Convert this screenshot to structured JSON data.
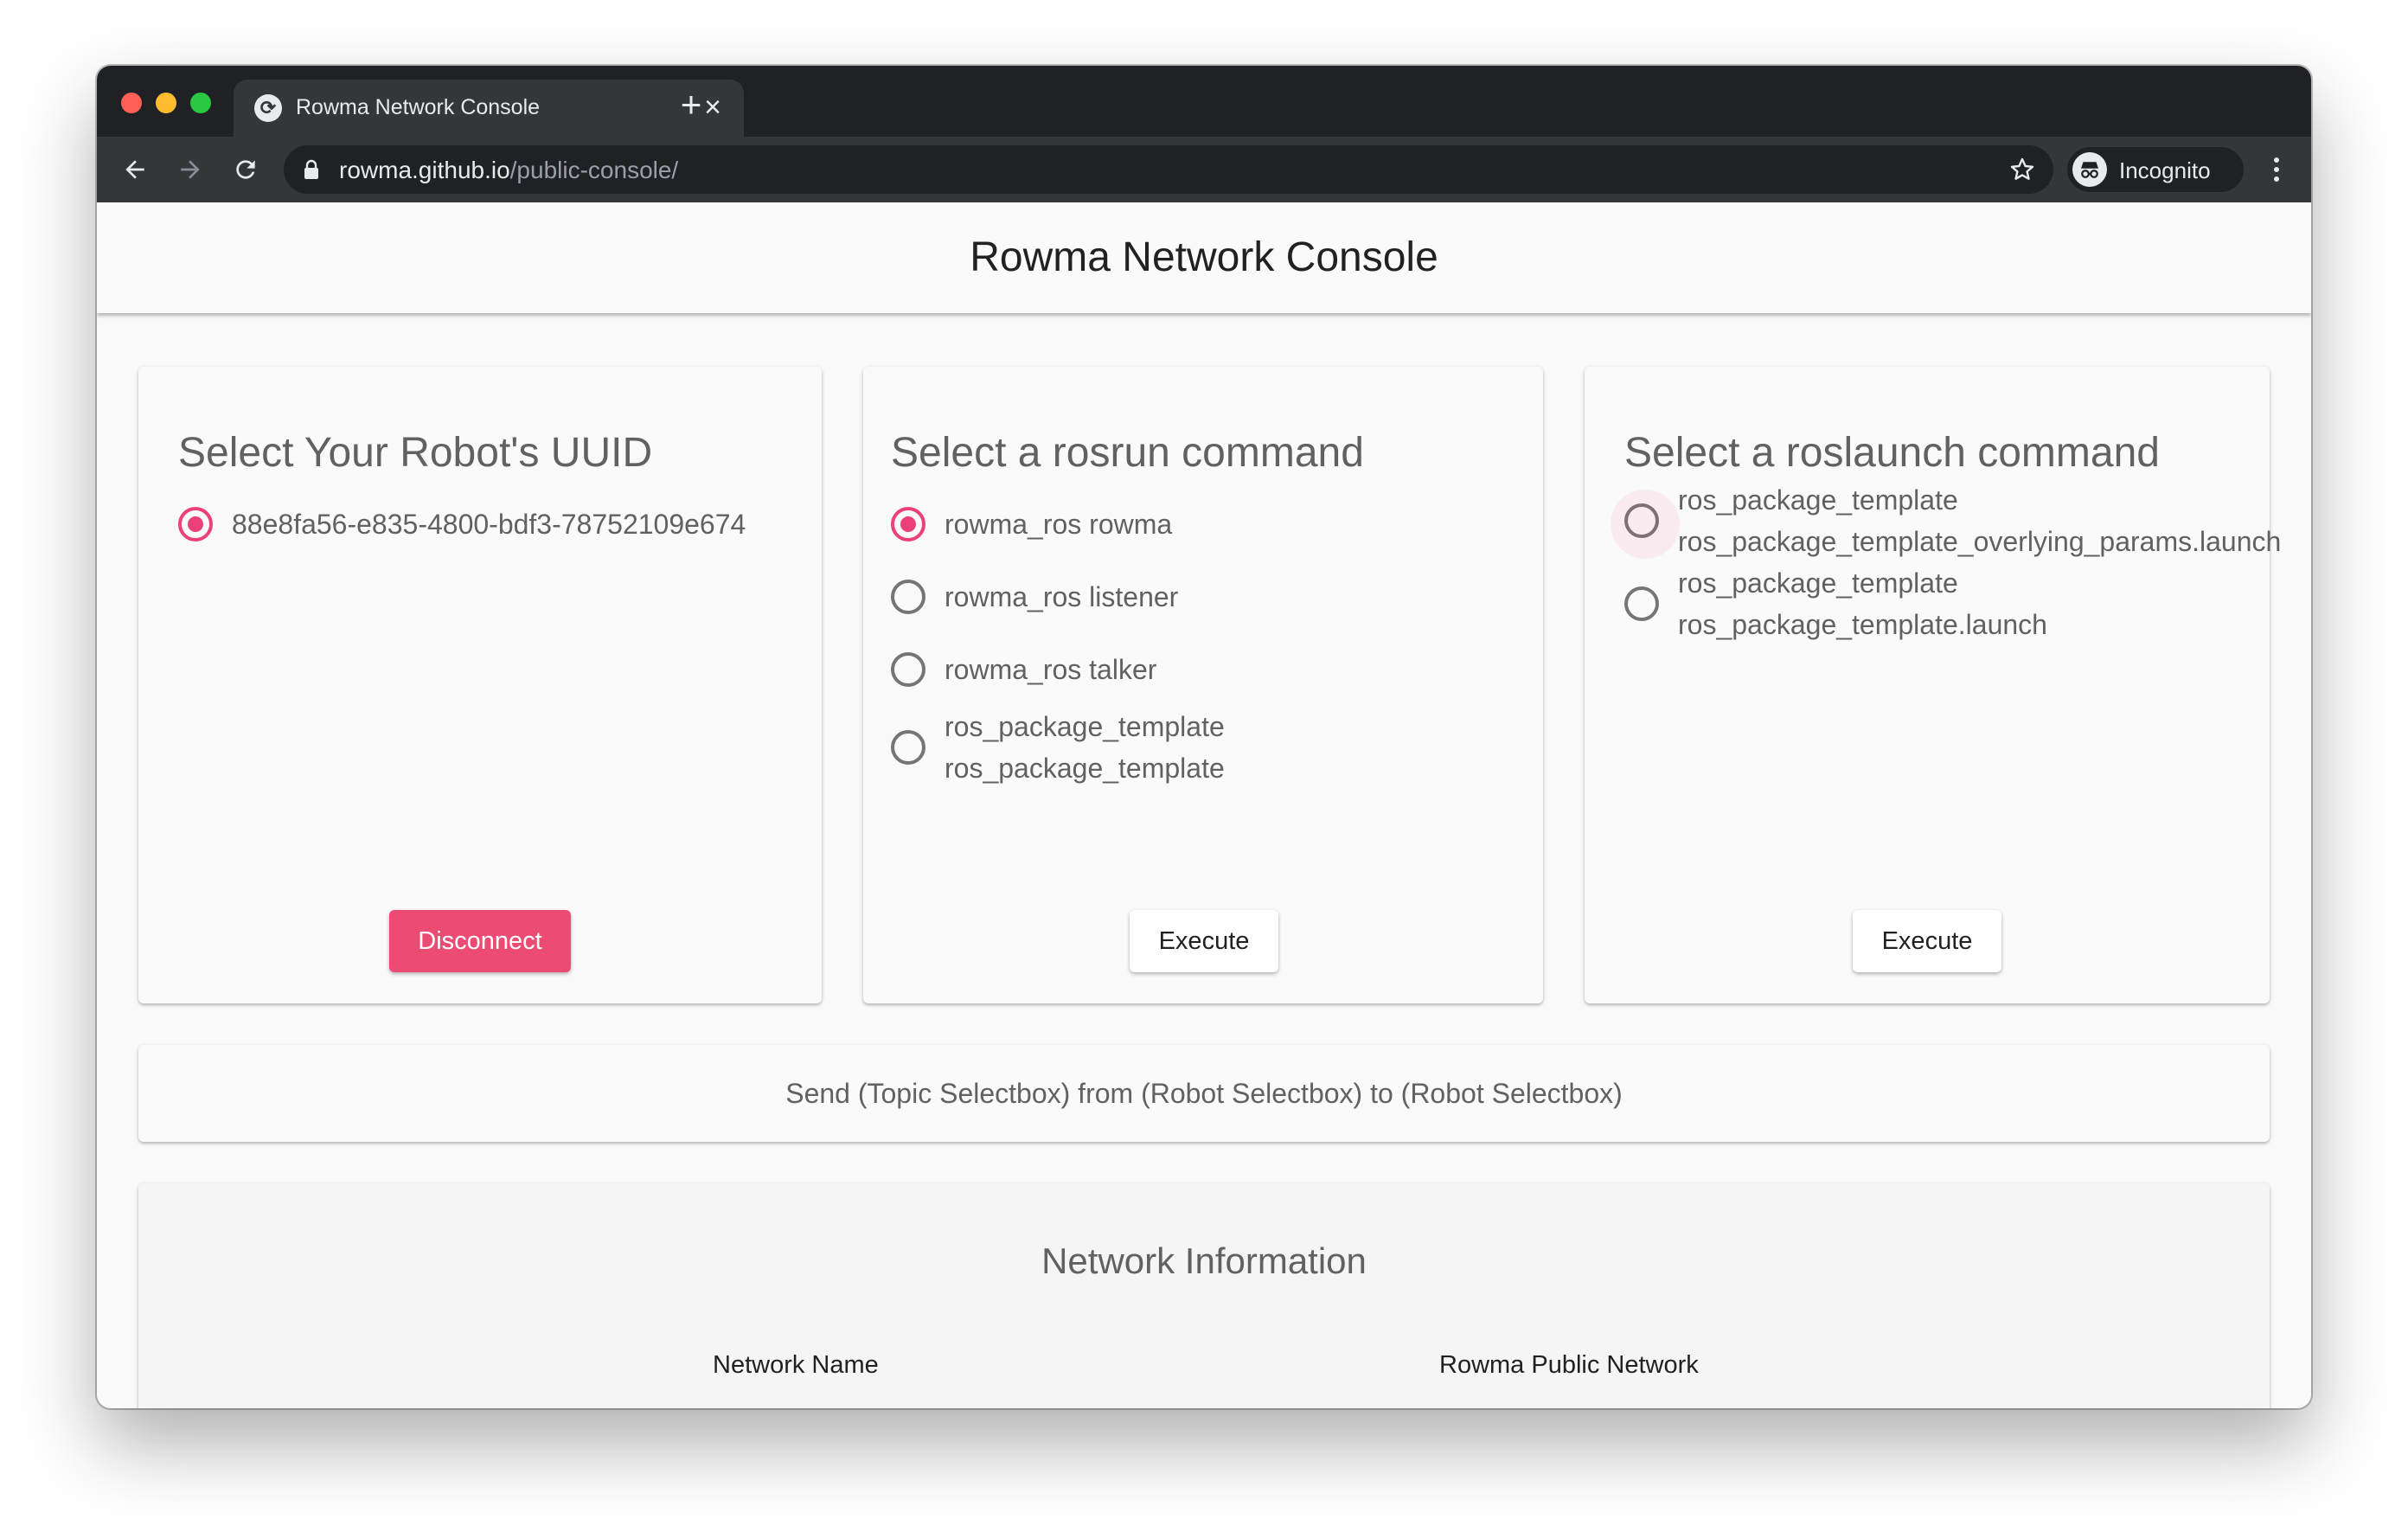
{
  "browser": {
    "tab_title": "Rowma Network Console",
    "url_host": "rowma.github.io",
    "url_path": "/public-console/",
    "incognito_label": "Incognito"
  },
  "app": {
    "title": "Rowma Network Console"
  },
  "robot_card": {
    "title": "Select Your Robot's UUID",
    "options": [
      {
        "label": "88e8fa56-e835-4800-bdf3-78752109e674",
        "selected": true
      }
    ],
    "button_label": "Disconnect"
  },
  "rosrun_card": {
    "title": "Select a rosrun command",
    "options": [
      {
        "label": "rowma_ros rowma",
        "selected": true
      },
      {
        "label": "rowma_ros listener",
        "selected": false
      },
      {
        "label": "rowma_ros talker",
        "selected": false
      },
      {
        "line1": "ros_package_template",
        "line2": "ros_package_template",
        "selected": false
      }
    ],
    "button_label": "Execute"
  },
  "roslaunch_card": {
    "title": "Select a roslaunch command",
    "options": [
      {
        "line1": "ros_package_template",
        "line2": "ros_package_template_overlying_params.launch",
        "selected": false
      },
      {
        "line1": "ros_package_template",
        "line2": "ros_package_template.launch",
        "selected": false
      }
    ],
    "button_label": "Execute"
  },
  "send_bar": {
    "text": "Send (Topic Selectbox) from (Robot Selectbox) to (Robot Selectbox)"
  },
  "network_info": {
    "title": "Network Information",
    "rows": [
      {
        "label": "Network Name",
        "value": "Rowma Public Network"
      }
    ]
  },
  "colors": {
    "accent": "#ec407a",
    "button_primary": "#ec4c74",
    "chrome_dark": "#202124",
    "chrome_toolbar": "#35363a"
  },
  "icons": [
    "close-red",
    "minimize-yellow",
    "zoom-green",
    "rowma-favicon",
    "close-icon",
    "plus-icon",
    "arrow-back-icon",
    "arrow-forward-icon",
    "reload-icon",
    "lock-icon",
    "star-icon",
    "incognito-icon",
    "more-vert-icon"
  ]
}
